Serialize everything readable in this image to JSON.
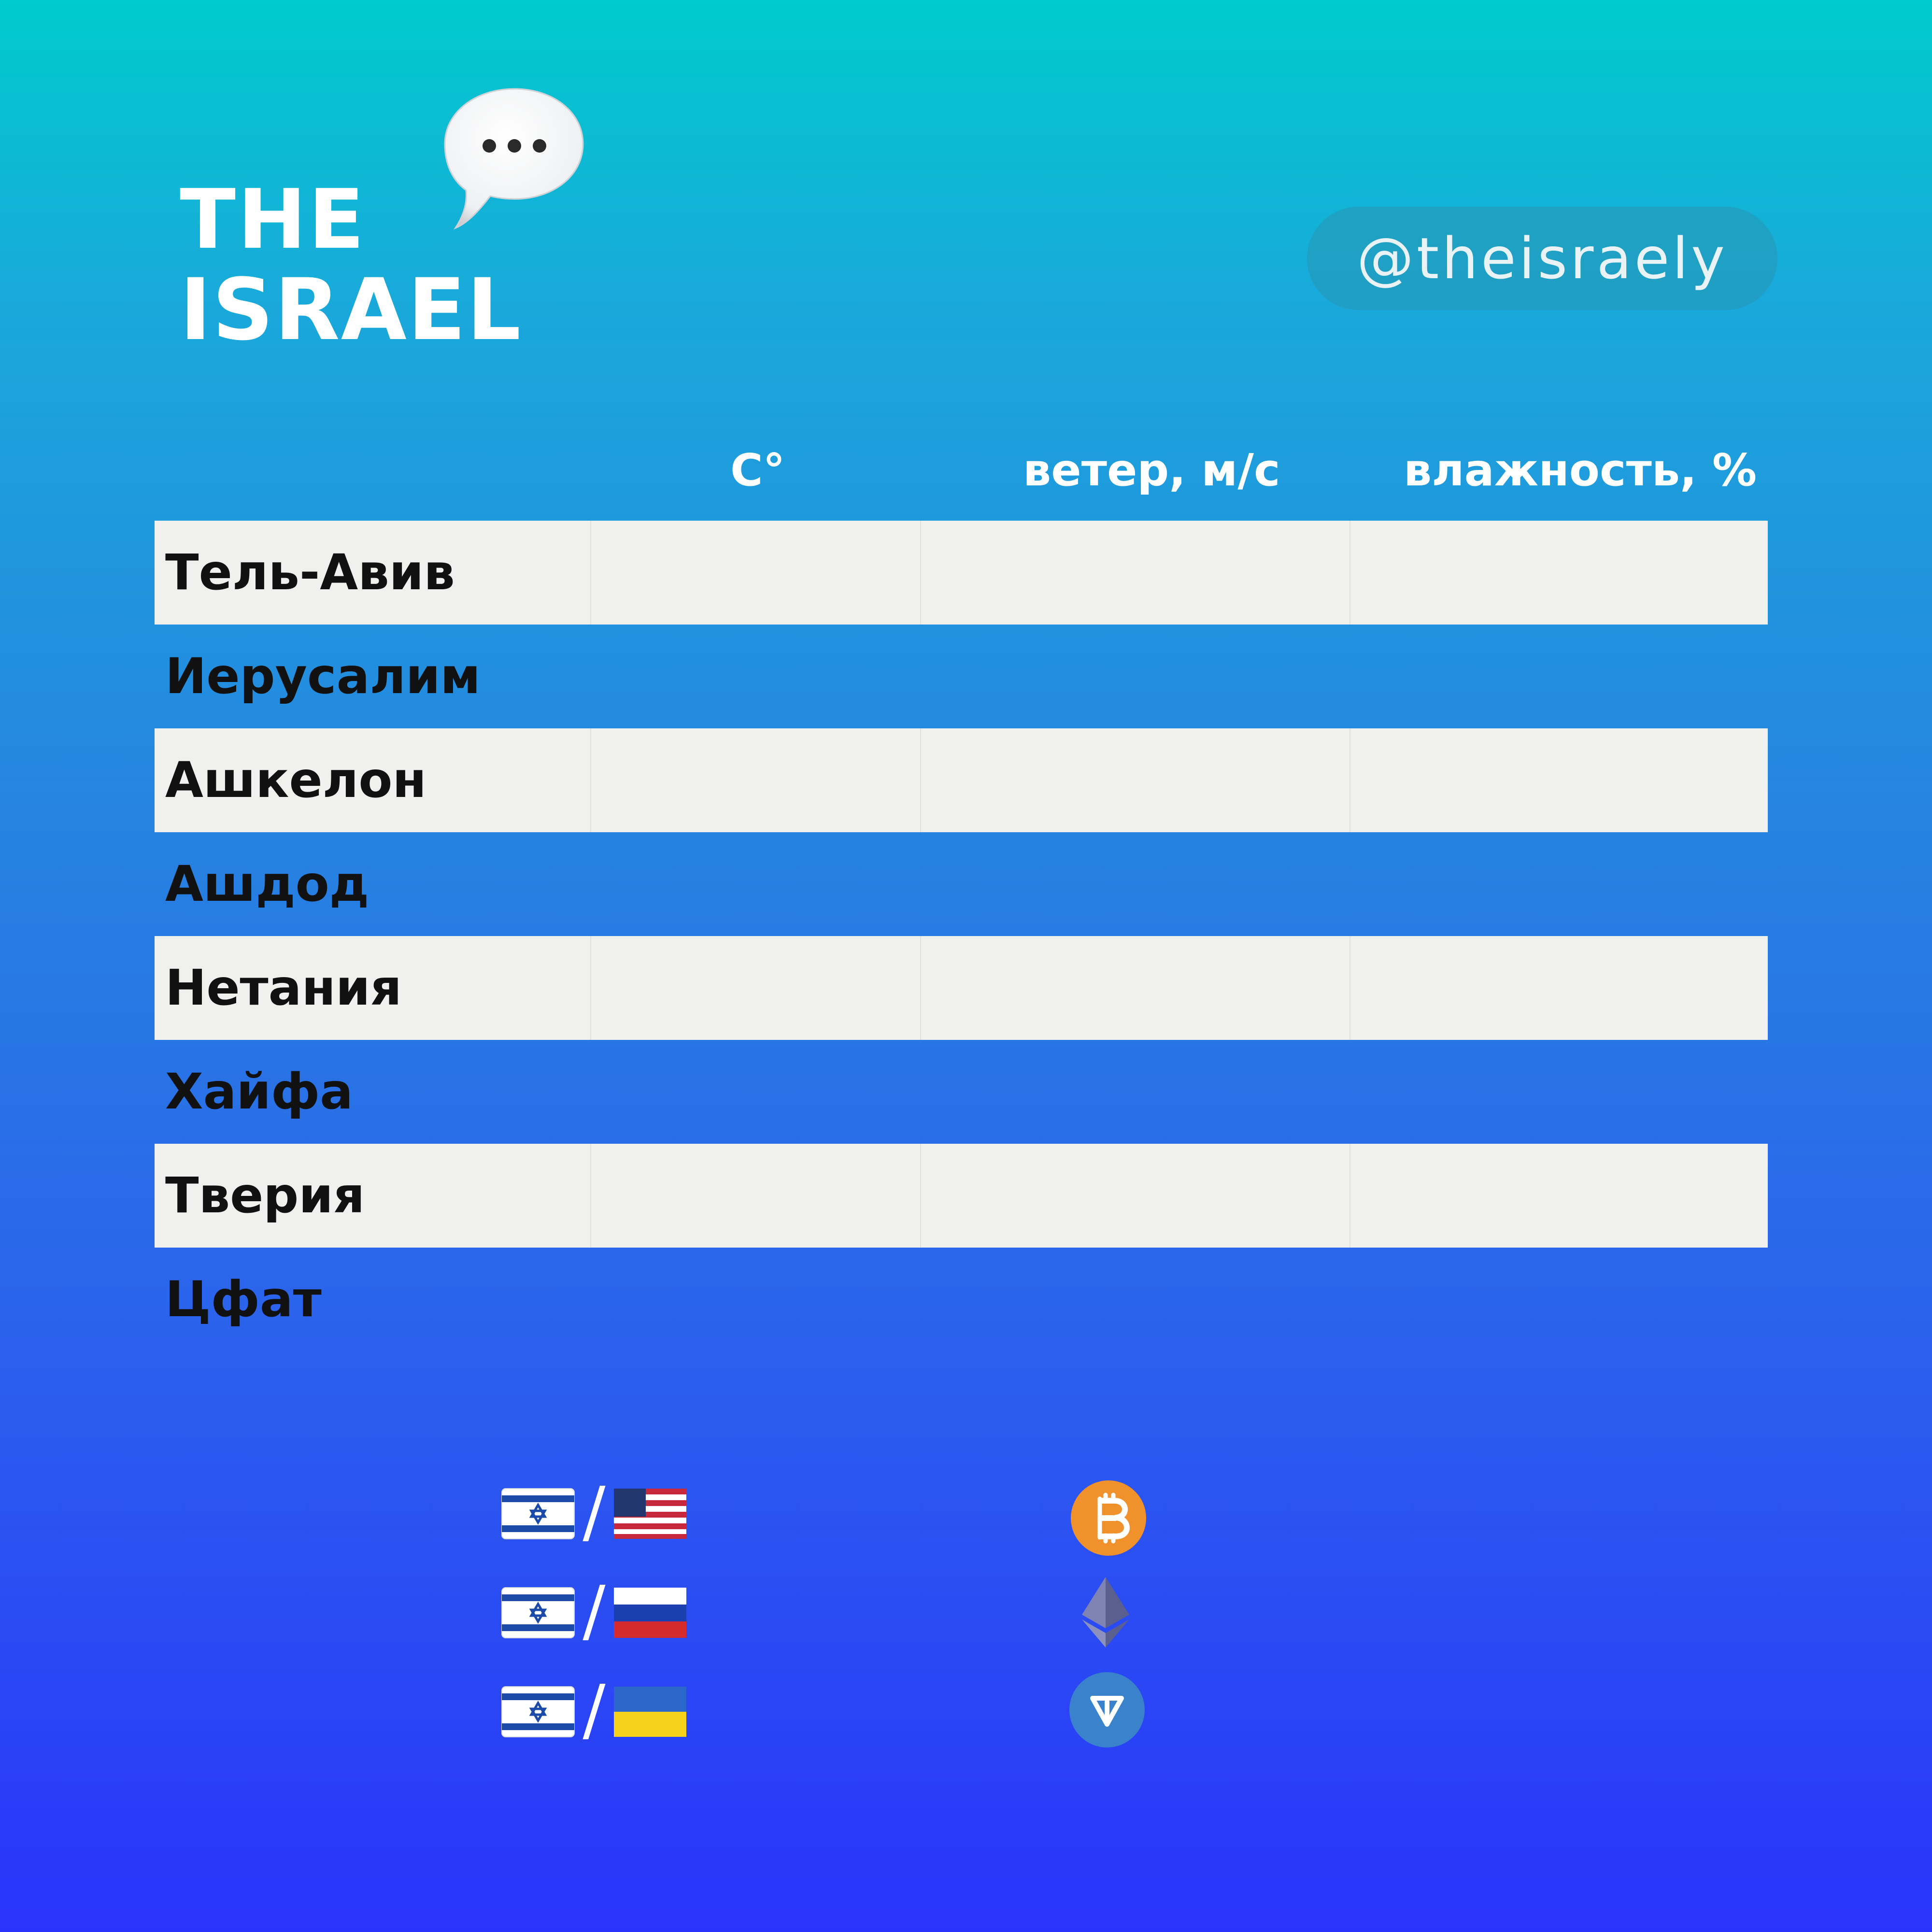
{
  "brand": {
    "line1": "THE",
    "line2": "ISRAEL",
    "handle": "@theisraely"
  },
  "table": {
    "columns": [
      "C°",
      "ветер, м/с",
      "влажность, %"
    ],
    "rows": [
      {
        "city": "Тель-Авив",
        "shaded": true
      },
      {
        "city": "Иерусалим",
        "shaded": false
      },
      {
        "city": "Ашкелон",
        "shaded": true
      },
      {
        "city": "Ашдод",
        "shaded": false
      },
      {
        "city": "Нетания",
        "shaded": true
      },
      {
        "city": "Хайфа",
        "shaded": false
      },
      {
        "city": "Тверия",
        "shaded": true
      },
      {
        "city": "Цфат",
        "shaded": false
      }
    ]
  },
  "currencies": {
    "pairs": [
      {
        "from_icon": "israel-flag-icon",
        "separator": "/",
        "to_icon": "usa-flag-icon"
      },
      {
        "from_icon": "israel-flag-icon",
        "separator": "/",
        "to_icon": "russia-flag-icon"
      },
      {
        "from_icon": "israel-flag-icon",
        "separator": "/",
        "to_icon": "ukraine-flag-icon"
      }
    ],
    "crypto_icons": [
      "bitcoin-icon",
      "ethereum-icon",
      "ton-icon"
    ]
  },
  "colors": {
    "gradient_top": "#00cbcd",
    "gradient_bottom": "#2a33fb",
    "row_shade": "#f0f0ef",
    "bitcoin": "#f0912c",
    "ton": "#3a82cc"
  }
}
